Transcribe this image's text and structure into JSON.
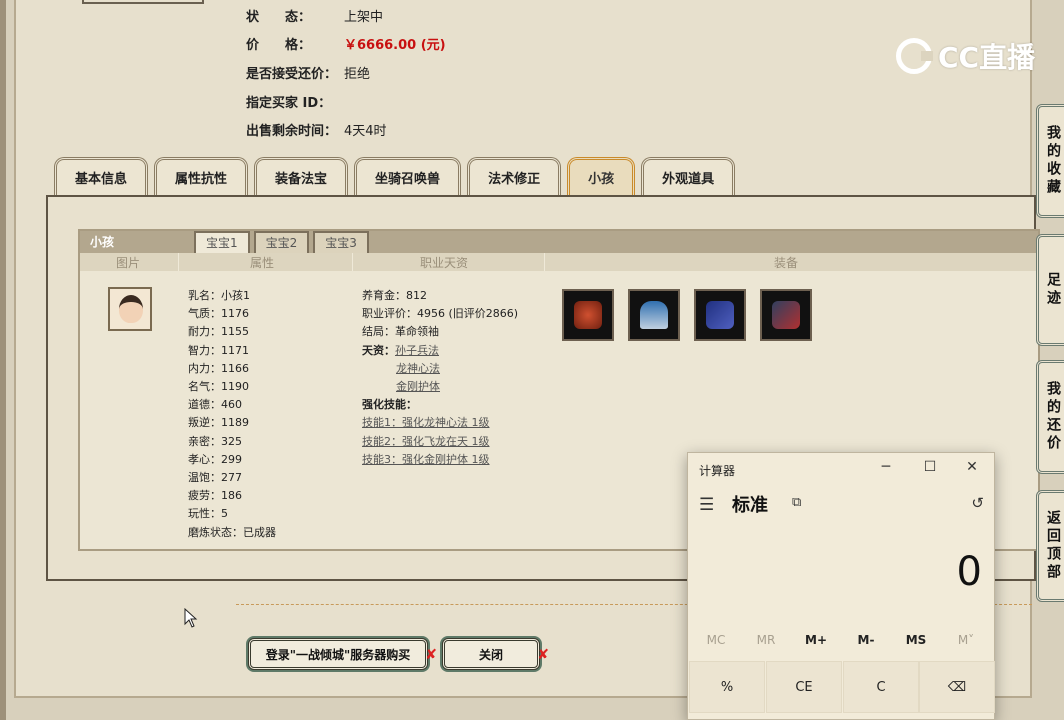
{
  "listing": {
    "status_label": "状　　态：",
    "status_value": "上架中",
    "price_label": "价　　格：",
    "price_value": "￥6666.00 (元)",
    "counter_label": "是否接受还价：",
    "counter_value": "拒绝",
    "buyer_label": "指定买家 ID：",
    "buyer_value": "",
    "remain_label": "出售剩余时间：",
    "remain_value": "4天4时"
  },
  "logo": {
    "text": "CC直播"
  },
  "tabs": [
    "基本信息",
    "属性抗性",
    "装备法宝",
    "坐骑召唤兽",
    "法术修正",
    "小孩",
    "外观道具"
  ],
  "active_tab": "小孩",
  "child_panel": {
    "title": "小孩",
    "subtabs": [
      "宝宝1",
      "宝宝2",
      "宝宝3"
    ],
    "columns": [
      "图片",
      "属性",
      "职业天资",
      "装备"
    ],
    "attributes": [
      "乳名：小孩1",
      "气质：1176",
      "耐力：1155",
      "智力：1171",
      "内力：1166",
      "名气：1190",
      "道德：460",
      "叛逆：1189",
      "亲密：325",
      "孝心：299",
      "温饱：277",
      "疲劳：186",
      "玩性：5",
      "磨炼状态：已成器"
    ],
    "job": {
      "raise_money": "养育金：812",
      "job_score": "职业评价：4956 (旧评价2866)",
      "ending": "结局：革命领袖",
      "talent_label": "天资：",
      "talents": [
        "孙子兵法",
        "龙神心法",
        "金刚护体"
      ],
      "skills_label": "强化技能：",
      "skills": [
        "技能1：强化龙神心法 1级",
        "技能2：强化飞龙在天 1级",
        "技能3：强化金刚护体 1级"
      ]
    }
  },
  "buttons": {
    "buy": "登录\"一战倾城\"服务器购买",
    "close": "关闭"
  },
  "side_nav": [
    "我的收藏",
    "足迹",
    "我的还价",
    "返回顶部"
  ],
  "calculator": {
    "title": "计算器",
    "mode": "标准",
    "display": "0",
    "memory": [
      "MC",
      "MR",
      "M+",
      "M-",
      "MS",
      "M˅"
    ],
    "keys": [
      "%",
      "CE",
      "C",
      "⌫"
    ]
  }
}
